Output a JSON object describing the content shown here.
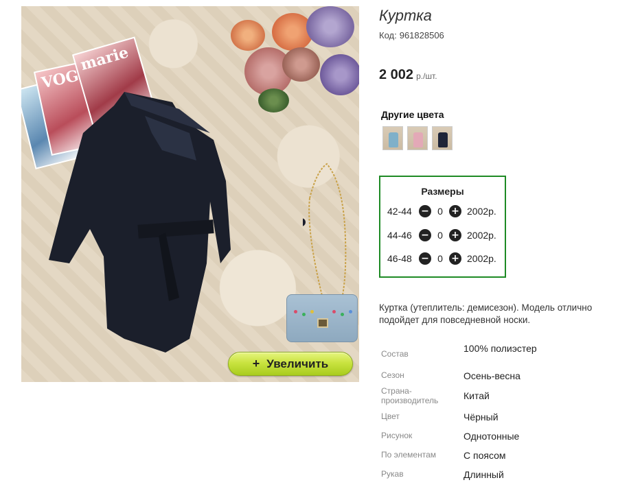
{
  "photo": {
    "magazine_titles": [
      "VOG",
      "marie"
    ],
    "zoom_button_label": "Увеличить",
    "zoom_icon": "plus-icon"
  },
  "product": {
    "title": "Куртка",
    "code_label": "Код:",
    "code_value": "961828506",
    "price_value": "2 002",
    "price_unit": "р./шт."
  },
  "other_colors": {
    "title": "Другие цвета",
    "swatches": [
      {
        "name": "light-blue",
        "color": "#7fb0c9"
      },
      {
        "name": "pink",
        "color": "#e3a9b7"
      },
      {
        "name": "navy",
        "color": "#1e2438"
      }
    ]
  },
  "sizes": {
    "title": "Размеры",
    "rows": [
      {
        "size": "42-44",
        "qty": "0",
        "price": "2002р."
      },
      {
        "size": "44-46",
        "qty": "0",
        "price": "2002р."
      },
      {
        "size": "46-48",
        "qty": "0",
        "price": "2002р."
      }
    ],
    "minus_symbol": "−",
    "plus_symbol": "+"
  },
  "description": "Куртка (утеплитель: демисезон). Модель отлично подойдет для повседневной носки.",
  "properties": [
    {
      "key": "Состав",
      "value": "100% полиэстер"
    },
    {
      "key": "Сезон",
      "value": "Осень-весна"
    },
    {
      "key": "Страна-производитель",
      "value": "Китай"
    },
    {
      "key": "Цвет",
      "value": "Чёрный"
    },
    {
      "key": "Рисунок",
      "value": "Однотонные"
    },
    {
      "key": "По элементам",
      "value": "С поясом"
    },
    {
      "key": "Рукав",
      "value": "Длинный"
    }
  ],
  "colors": {
    "accent_border": "#1d8a24",
    "zoom_button": "#c9e340",
    "coat": "#1b1f2b"
  }
}
